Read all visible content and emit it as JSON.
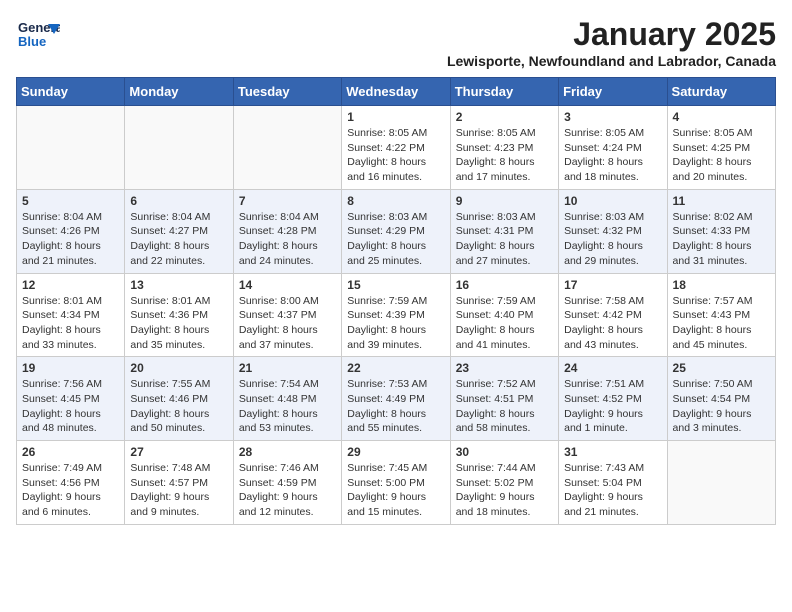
{
  "header": {
    "logo_general": "General",
    "logo_blue": "Blue",
    "month": "January 2025",
    "location": "Lewisporte, Newfoundland and Labrador, Canada"
  },
  "weekdays": [
    "Sunday",
    "Monday",
    "Tuesday",
    "Wednesday",
    "Thursday",
    "Friday",
    "Saturday"
  ],
  "weeks": [
    [
      {
        "day": "",
        "info": ""
      },
      {
        "day": "",
        "info": ""
      },
      {
        "day": "",
        "info": ""
      },
      {
        "day": "1",
        "info": "Sunrise: 8:05 AM\nSunset: 4:22 PM\nDaylight: 8 hours and 16 minutes."
      },
      {
        "day": "2",
        "info": "Sunrise: 8:05 AM\nSunset: 4:23 PM\nDaylight: 8 hours and 17 minutes."
      },
      {
        "day": "3",
        "info": "Sunrise: 8:05 AM\nSunset: 4:24 PM\nDaylight: 8 hours and 18 minutes."
      },
      {
        "day": "4",
        "info": "Sunrise: 8:05 AM\nSunset: 4:25 PM\nDaylight: 8 hours and 20 minutes."
      }
    ],
    [
      {
        "day": "5",
        "info": "Sunrise: 8:04 AM\nSunset: 4:26 PM\nDaylight: 8 hours and 21 minutes."
      },
      {
        "day": "6",
        "info": "Sunrise: 8:04 AM\nSunset: 4:27 PM\nDaylight: 8 hours and 22 minutes."
      },
      {
        "day": "7",
        "info": "Sunrise: 8:04 AM\nSunset: 4:28 PM\nDaylight: 8 hours and 24 minutes."
      },
      {
        "day": "8",
        "info": "Sunrise: 8:03 AM\nSunset: 4:29 PM\nDaylight: 8 hours and 25 minutes."
      },
      {
        "day": "9",
        "info": "Sunrise: 8:03 AM\nSunset: 4:31 PM\nDaylight: 8 hours and 27 minutes."
      },
      {
        "day": "10",
        "info": "Sunrise: 8:03 AM\nSunset: 4:32 PM\nDaylight: 8 hours and 29 minutes."
      },
      {
        "day": "11",
        "info": "Sunrise: 8:02 AM\nSunset: 4:33 PM\nDaylight: 8 hours and 31 minutes."
      }
    ],
    [
      {
        "day": "12",
        "info": "Sunrise: 8:01 AM\nSunset: 4:34 PM\nDaylight: 8 hours and 33 minutes."
      },
      {
        "day": "13",
        "info": "Sunrise: 8:01 AM\nSunset: 4:36 PM\nDaylight: 8 hours and 35 minutes."
      },
      {
        "day": "14",
        "info": "Sunrise: 8:00 AM\nSunset: 4:37 PM\nDaylight: 8 hours and 37 minutes."
      },
      {
        "day": "15",
        "info": "Sunrise: 7:59 AM\nSunset: 4:39 PM\nDaylight: 8 hours and 39 minutes."
      },
      {
        "day": "16",
        "info": "Sunrise: 7:59 AM\nSunset: 4:40 PM\nDaylight: 8 hours and 41 minutes."
      },
      {
        "day": "17",
        "info": "Sunrise: 7:58 AM\nSunset: 4:42 PM\nDaylight: 8 hours and 43 minutes."
      },
      {
        "day": "18",
        "info": "Sunrise: 7:57 AM\nSunset: 4:43 PM\nDaylight: 8 hours and 45 minutes."
      }
    ],
    [
      {
        "day": "19",
        "info": "Sunrise: 7:56 AM\nSunset: 4:45 PM\nDaylight: 8 hours and 48 minutes."
      },
      {
        "day": "20",
        "info": "Sunrise: 7:55 AM\nSunset: 4:46 PM\nDaylight: 8 hours and 50 minutes."
      },
      {
        "day": "21",
        "info": "Sunrise: 7:54 AM\nSunset: 4:48 PM\nDaylight: 8 hours and 53 minutes."
      },
      {
        "day": "22",
        "info": "Sunrise: 7:53 AM\nSunset: 4:49 PM\nDaylight: 8 hours and 55 minutes."
      },
      {
        "day": "23",
        "info": "Sunrise: 7:52 AM\nSunset: 4:51 PM\nDaylight: 8 hours and 58 minutes."
      },
      {
        "day": "24",
        "info": "Sunrise: 7:51 AM\nSunset: 4:52 PM\nDaylight: 9 hours and 1 minute."
      },
      {
        "day": "25",
        "info": "Sunrise: 7:50 AM\nSunset: 4:54 PM\nDaylight: 9 hours and 3 minutes."
      }
    ],
    [
      {
        "day": "26",
        "info": "Sunrise: 7:49 AM\nSunset: 4:56 PM\nDaylight: 9 hours and 6 minutes."
      },
      {
        "day": "27",
        "info": "Sunrise: 7:48 AM\nSunset: 4:57 PM\nDaylight: 9 hours and 9 minutes."
      },
      {
        "day": "28",
        "info": "Sunrise: 7:46 AM\nSunset: 4:59 PM\nDaylight: 9 hours and 12 minutes."
      },
      {
        "day": "29",
        "info": "Sunrise: 7:45 AM\nSunset: 5:00 PM\nDaylight: 9 hours and 15 minutes."
      },
      {
        "day": "30",
        "info": "Sunrise: 7:44 AM\nSunset: 5:02 PM\nDaylight: 9 hours and 18 minutes."
      },
      {
        "day": "31",
        "info": "Sunrise: 7:43 AM\nSunset: 5:04 PM\nDaylight: 9 hours and 21 minutes."
      },
      {
        "day": "",
        "info": ""
      }
    ]
  ]
}
